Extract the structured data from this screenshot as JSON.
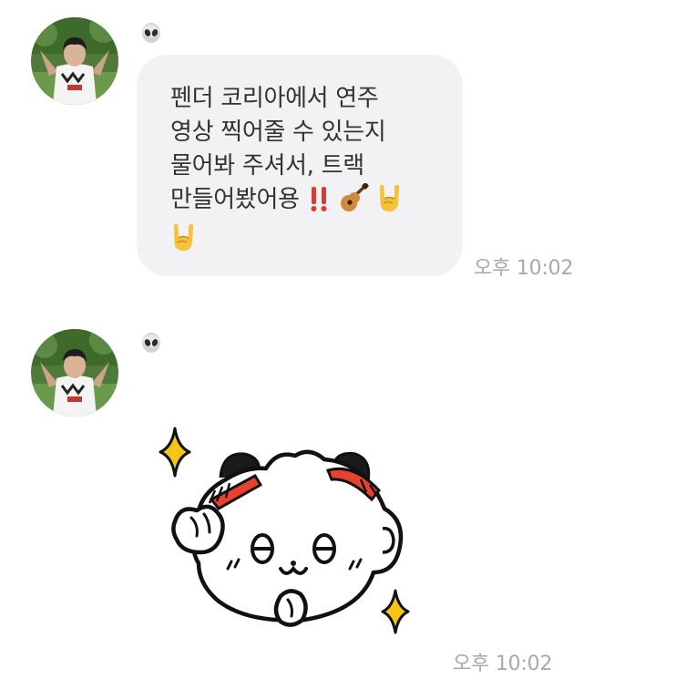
{
  "messages": [
    {
      "sender_icon": "alien-icon",
      "type": "text",
      "text_line1": "펜더 코리아에서 연주",
      "text_line2": "영상 찍어줄 수 있는지",
      "text_line3": "물어봐 주셔서, 트랙",
      "text_line4": "만들어봤어용 ",
      "emojis": [
        "double-exclamation-icon",
        "guitar-icon",
        "sign-of-horns-icon",
        "sign-of-horns-icon"
      ],
      "time": "오후 10:02"
    },
    {
      "sender_icon": "alien-icon",
      "type": "sticker",
      "sticker": "white-bear-sticker-icon",
      "time": "오후 10:02"
    }
  ],
  "colors": {
    "bubble_bg": "#f2f2f4",
    "text": "#333333",
    "time": "#a8a8b0",
    "sticker_red": "#e8412c",
    "sparkle_yellow": "#f5c518"
  }
}
